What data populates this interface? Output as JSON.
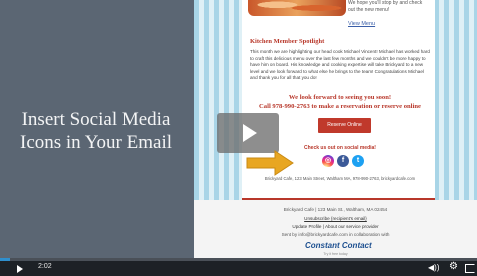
{
  "left_title": "Insert Social Media Icons in Your Email",
  "email": {
    "top_text": "We hope you'll stop by and check out the new menu!",
    "view_menu": "View Menu",
    "spotlight_title": "Kitchen Member Spotlight",
    "spotlight_body": "This month we are highlighting our head cook Michael Vincent! Michael has worked hard to craft this delicious menu over the last few months and we couldn't be more happy to have him on board. His knowledge and cooking expertise will take Brickyard to a new level and we look forward to what else he brings to the team! Congratulations Michael and thank you for all that you do!",
    "look_forward_1": "We look forward to seeing you soon!",
    "look_forward_2": "Call 978-990-2763 to make a reservation or reserve online",
    "reserve_button": "Reserve Online",
    "social_label": "Check us out on social media!",
    "social_icons": [
      "instagram-icon",
      "facebook-icon",
      "twitter-icon"
    ],
    "footer_line": "Brickyard Cafe, 123 Main Street, Waltham MA, 978-990-2763, brickyardcafe.com"
  },
  "footer": {
    "address": "Brickyard Cafe | 123 Main St., Waltham, MA 02454",
    "unsubscribe": "Unsubscribe {recipient's email}",
    "update_profile": "Update Profile | About our service provider",
    "sent_by": "Sent by info@brickyardcafe.com in collaboration with",
    "cc_logo": "Constant Contact",
    "cc_sub": "Try it free today"
  },
  "player": {
    "time": "2:02",
    "progress": 0.02,
    "accent": "#2f8fcd",
    "volume_glyph": "◀))",
    "settings_glyph": "⚙"
  }
}
